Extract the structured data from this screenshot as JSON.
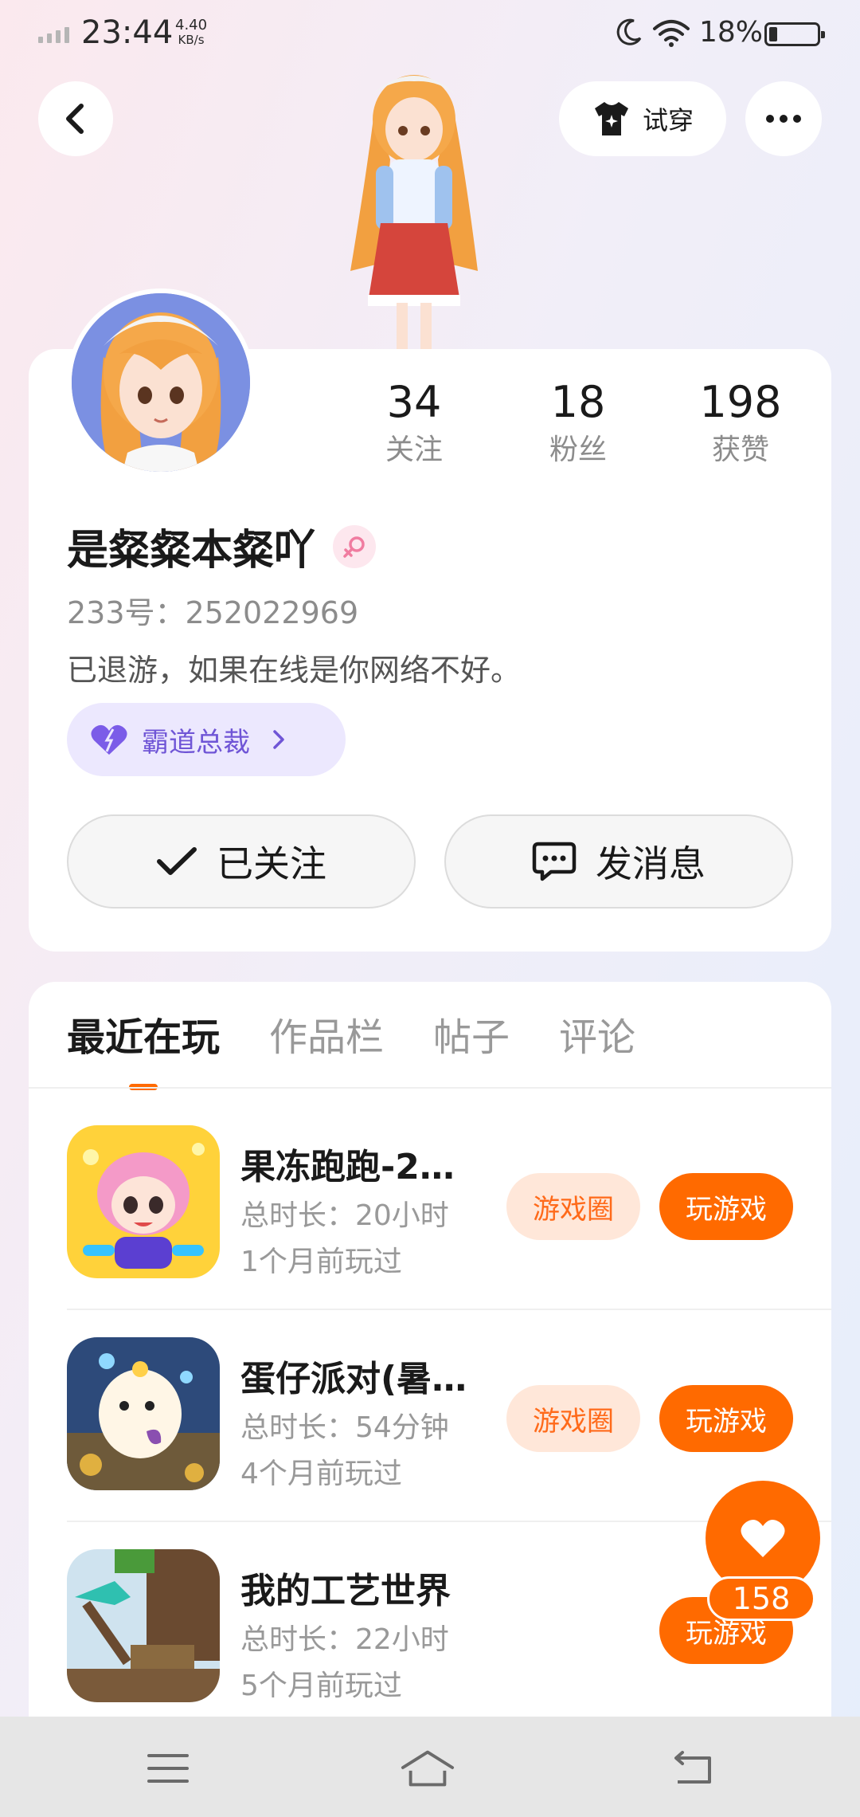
{
  "status_bar": {
    "time": "23:44",
    "net_speed_value": "4.40",
    "net_speed_unit": "KB/s",
    "battery": "18%"
  },
  "header": {
    "tryon_label": "试穿"
  },
  "profile": {
    "stats": [
      {
        "value": "34",
        "label": "关注"
      },
      {
        "value": "18",
        "label": "粉丝"
      },
      {
        "value": "198",
        "label": "获赞"
      }
    ],
    "nickname": "是粲粲本粲吖",
    "uid": "233号：252022969",
    "bio": "已退游，如果在线是你网络不好。",
    "title_badge": "霸道总裁",
    "follow_button": "已关注",
    "message_button": "发消息"
  },
  "tabs": [
    {
      "label": "最近在玩",
      "active": true
    },
    {
      "label": "作品栏",
      "active": false
    },
    {
      "label": "帖子",
      "active": false
    },
    {
      "label": "评论",
      "active": false
    }
  ],
  "games": [
    {
      "name": "果冻跑跑-2…",
      "duration": "总时长：20小时",
      "last_played": "1个月前玩过",
      "circle_label": "游戏圈",
      "play_label": "玩游戏"
    },
    {
      "name": "蛋仔派对(暑…",
      "duration": "总时长：54分钟",
      "last_played": "4个月前玩过",
      "circle_label": "游戏圈",
      "play_label": "玩游戏"
    },
    {
      "name": "我的工艺世界",
      "duration": "总时长：22小时",
      "last_played": "5个月前玩过",
      "circle_label": "",
      "play_label": "玩游戏"
    }
  ],
  "like": {
    "count": "158"
  },
  "colors": {
    "accent": "#ff6a00",
    "badge_purple": "#6f55d6"
  }
}
